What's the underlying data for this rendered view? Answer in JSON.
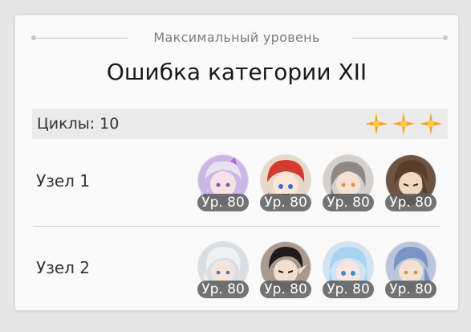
{
  "header": {
    "subtitle": "Максимальный уровень",
    "title": "Ошибка категории XII"
  },
  "cycles": {
    "label": "Циклы: 10",
    "stars": 3,
    "star_color": "#f5a623"
  },
  "nodes": [
    {
      "label": "Узел 1",
      "characters": [
        {
          "icon": "silver-hair-girl-portrait",
          "level": "Ур. 80"
        },
        {
          "icon": "red-hair-girl-portrait",
          "level": "Ур. 80"
        },
        {
          "icon": "grey-hair-woman-portrait",
          "level": "Ур. 80"
        },
        {
          "icon": "brown-hair-man-portrait",
          "level": "Ур. 80"
        }
      ]
    },
    {
      "label": "Узел 2",
      "characters": [
        {
          "icon": "white-hair-man-portrait",
          "level": "Ур. 80"
        },
        {
          "icon": "black-hair-elf-portrait",
          "level": "Ур. 80"
        },
        {
          "icon": "light-blue-hair-girl-portrait",
          "level": "Ур. 80"
        },
        {
          "icon": "blue-hair-man-portrait",
          "level": "Ур. 80"
        }
      ]
    }
  ]
}
